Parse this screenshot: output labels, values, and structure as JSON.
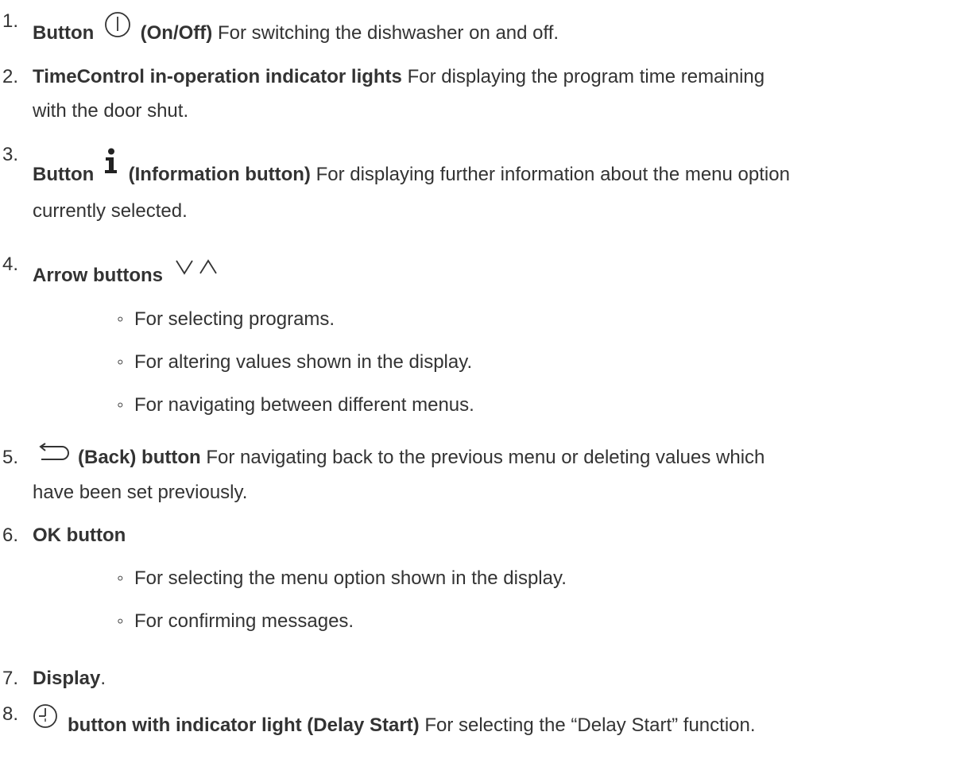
{
  "items": [
    {
      "number": "1.",
      "bold_before_icon": "Button",
      "icon": "power-icon",
      "bold_after_icon": "(On/Off)",
      "text": "For switching the dishwasher on and off."
    },
    {
      "number": "2.",
      "bold": "TimeControl in-operation indicator lights",
      "text": "For displaying the program time remaining",
      "text_line2": "with the door shut."
    },
    {
      "number": "3.",
      "bold_before_icon": "Button",
      "icon": "info-icon",
      "bold_after_icon": "(Information button)",
      "text": "For displaying further information about the menu option",
      "text_line2": "currently selected."
    },
    {
      "number": "4.",
      "bold": "Arrow buttons",
      "icon": "arrow-down-up-icon",
      "subitems": [
        "For selecting programs.",
        "For altering values shown in the display.",
        "For navigating between different menus."
      ]
    },
    {
      "number": "5.",
      "icon": "back-icon",
      "bold": "(Back) button",
      "text": "For navigating back to the previous menu or deleting values which",
      "text_line2": "have been set previously."
    },
    {
      "number": "6.",
      "bold": "OK button",
      "subitems": [
        "For selecting the menu option shown in the display.",
        "For confirming messages."
      ]
    },
    {
      "number": "7.",
      "bold": "Display",
      "text": "."
    },
    {
      "number": "8.",
      "icon": "clock-icon",
      "bold": "button with indicator light (Delay Start)",
      "text": "For selecting the “Delay Start” function."
    }
  ],
  "bullet_glyph": "◦"
}
